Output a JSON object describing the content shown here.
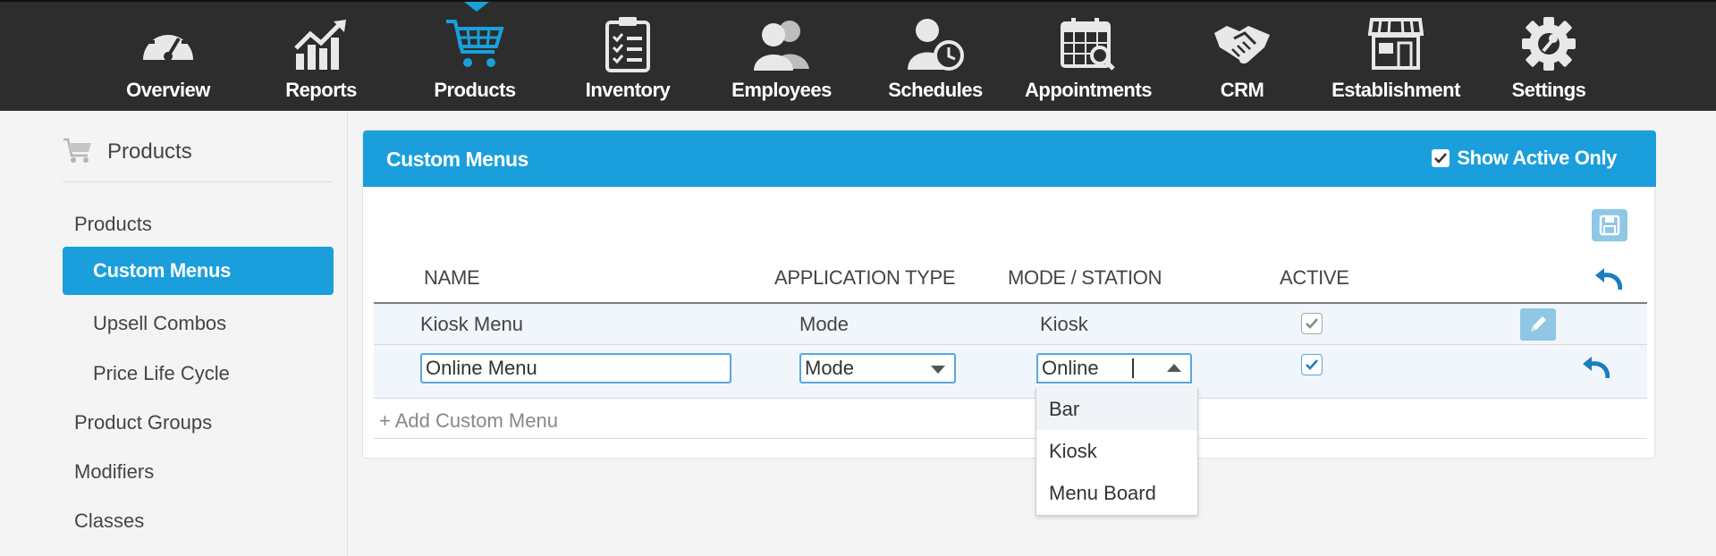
{
  "nav": {
    "items": [
      {
        "label": "Overview",
        "icon": "speedometer-icon"
      },
      {
        "label": "Reports",
        "icon": "chart-growth-icon"
      },
      {
        "label": "Products",
        "icon": "cart-icon",
        "active": true
      },
      {
        "label": "Inventory",
        "icon": "clipboard-checklist-icon"
      },
      {
        "label": "Employees",
        "icon": "people-icon"
      },
      {
        "label": "Schedules",
        "icon": "person-clock-icon"
      },
      {
        "label": "Appointments",
        "icon": "calendar-search-icon"
      },
      {
        "label": "CRM",
        "icon": "handshake-icon"
      },
      {
        "label": "Establishment",
        "icon": "storefront-icon"
      },
      {
        "label": "Settings",
        "icon": "gear-icon"
      }
    ],
    "accent": "#1a9fdc"
  },
  "sidebar": {
    "title": "Products",
    "items": [
      {
        "label": "Products"
      },
      {
        "label": "Custom Menus",
        "active": true
      },
      {
        "label": "Upsell Combos"
      },
      {
        "label": "Price Life Cycle"
      },
      {
        "label": "Product Groups"
      },
      {
        "label": "Modifiers"
      },
      {
        "label": "Classes"
      }
    ]
  },
  "panel": {
    "title": "Custom Menus",
    "show_active_label": "Show Active Only",
    "columns": [
      "NAME",
      "APPLICATION TYPE",
      "MODE / STATION",
      "ACTIVE"
    ],
    "rows": [
      {
        "name": "Kiosk Menu",
        "app_type": "Mode",
        "station": "Kiosk",
        "active": true
      },
      {
        "name": "Online Menu",
        "app_type": "Mode",
        "station": "Online",
        "active": true,
        "editing": true
      }
    ],
    "add_label": "+ Add Custom Menu",
    "dropdown_options": [
      "Bar",
      "Kiosk",
      "Menu Board"
    ]
  }
}
